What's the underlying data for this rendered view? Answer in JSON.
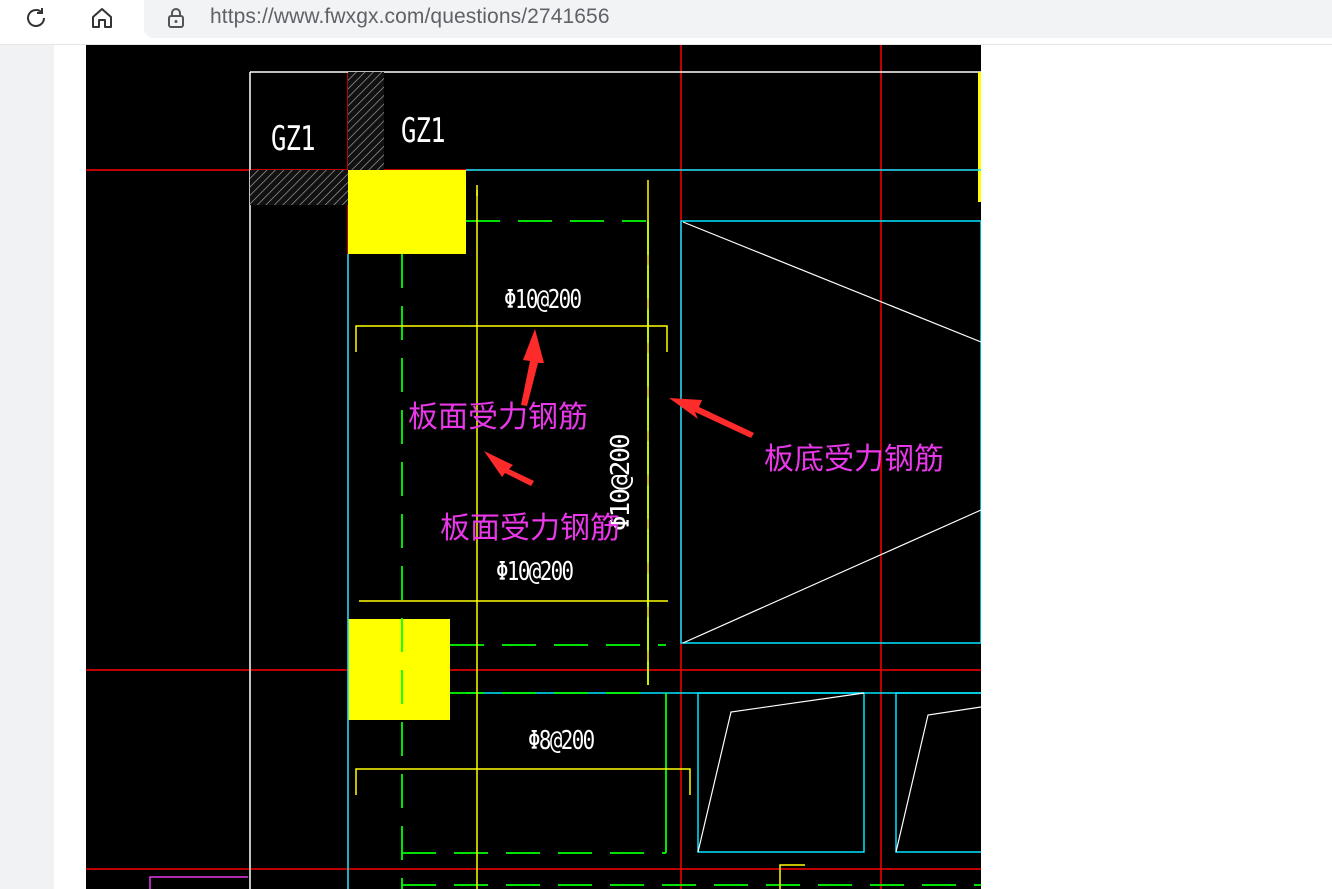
{
  "browser": {
    "url": "https://www.fwxgx.com/questions/2741656",
    "icons": {
      "reload": "reload-icon",
      "home": "home-icon",
      "lock": "lock-icon"
    }
  },
  "drawing": {
    "column_labels": [
      "GZ1",
      "GZ1"
    ],
    "rebar_labels": {
      "top": "Φ10@200",
      "vertical": "Φ10@200",
      "lower": "Φ10@200",
      "bottom": "Φ8@200"
    },
    "annotations": {
      "slab_top_1": "板面受力钢筋",
      "slab_top_2": "板面受力钢筋",
      "slab_bottom": "板底受力钢筋"
    },
    "colors": {
      "background": "#000000",
      "axis": "#ff0000",
      "wall": "#00ffff",
      "rebar_top": "#00ff00",
      "rebar_dim": "#ffff00",
      "column_fill": "#ffff00",
      "annotation": "#e838e8",
      "arrow": "#ff2a2a"
    }
  }
}
